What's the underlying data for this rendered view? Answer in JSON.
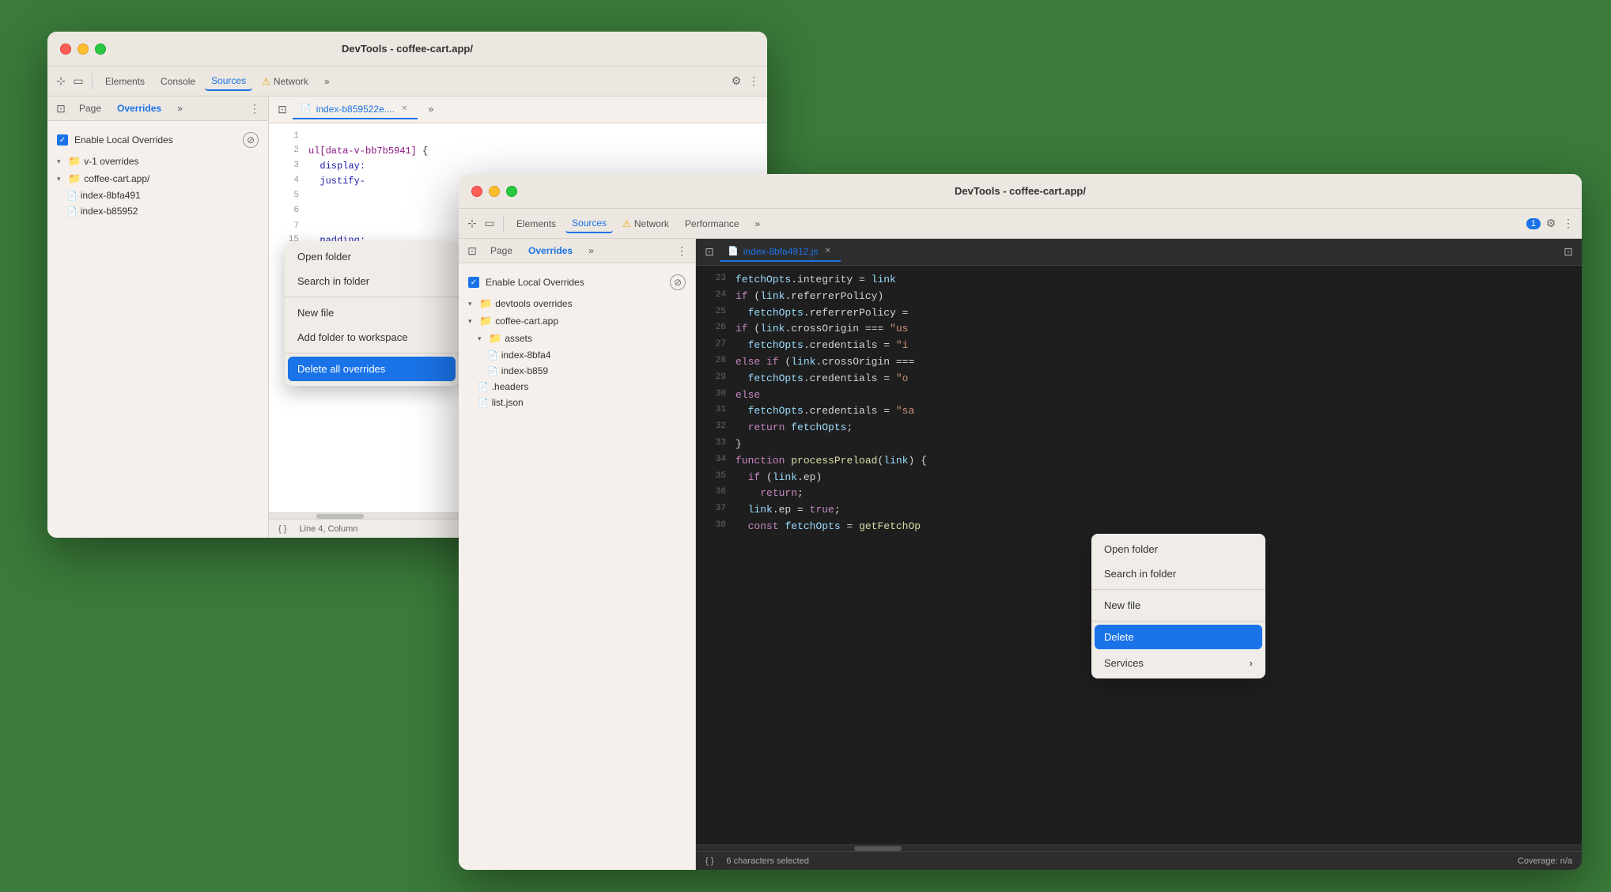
{
  "windows": {
    "back": {
      "title": "DevTools - coffee-cart.app/",
      "tabs": [
        "Elements",
        "Console",
        "Sources",
        "Network"
      ],
      "active_tab": "Sources",
      "sidebar": {
        "tabs": [
          "Page",
          "Overrides",
          ">>"
        ],
        "active_tab": "Overrides",
        "enable_overrides": "Enable Local Overrides",
        "tree": {
          "root": "v-1 overrides",
          "child": "coffee-cart.app/",
          "files": [
            "index-8bfa491",
            "index-b85952"
          ]
        }
      },
      "context_menu": {
        "items": [
          "Open folder",
          "Search in folder",
          "New file",
          "Add folder to workspace",
          "Delete all overrides"
        ]
      },
      "code_tab": "index-b859522e....",
      "code_lines": [
        {
          "num": 1,
          "text": ""
        },
        {
          "num": 2,
          "text": "ul[data-v-bb7b5941] {"
        },
        {
          "num": 3,
          "text": "  display:"
        },
        {
          "num": 4,
          "text": "  justify-"
        }
      ],
      "status": "Line 4, Column"
    },
    "front": {
      "title": "DevTools - coffee-cart.app/",
      "tabs": [
        "Elements",
        "Sources",
        "Network",
        "Performance",
        ">>"
      ],
      "active_tab": "Sources",
      "badge": "1",
      "sidebar": {
        "tabs": [
          "Page",
          "Overrides",
          ">>"
        ],
        "active_tab": "Overrides",
        "enable_overrides": "Enable Local Overrides",
        "tree": {
          "root": "devtools overrides",
          "child": "coffee-cart.app",
          "subchild": "assets",
          "files": [
            "index-8bfa4",
            "index-b859"
          ],
          "root_files": [
            ".headers",
            "list.json"
          ]
        }
      },
      "context_menu": {
        "items": [
          "Open folder",
          "Search in folder",
          "New file",
          "Delete",
          "Services"
        ]
      },
      "code_tab": "index-8bfa4912.js",
      "code_lines": [
        {
          "num": 23,
          "content": "fetchOpts.integrity = link"
        },
        {
          "num": 24,
          "content": "if (link.referrerPolicy)"
        },
        {
          "num": 25,
          "content": "  fetchOpts.referrerPolicy ="
        },
        {
          "num": 26,
          "content": "if (link.crossOrigin === \"us"
        },
        {
          "num": 27,
          "content": "  fetchOpts.credentials = \"i"
        },
        {
          "num": 28,
          "content": "else if (link.crossOrigin ==="
        },
        {
          "num": 29,
          "content": "  fetchOpts.credentials = \"o"
        },
        {
          "num": 30,
          "content": "else"
        },
        {
          "num": 31,
          "content": "  fetchOpts.credentials = \"sa"
        },
        {
          "num": 32,
          "content": "  return fetchOpts;"
        },
        {
          "num": 33,
          "content": "}"
        },
        {
          "num": 34,
          "content": "function processPreload(link) {"
        },
        {
          "num": 35,
          "content": "  if (link.ep)"
        },
        {
          "num": 36,
          "content": "    return;"
        },
        {
          "num": 37,
          "content": "  link.ep = true;"
        },
        {
          "num": 38,
          "content": "  const fetchOpts = getFetchOp"
        }
      ],
      "status_left": "6 characters selected",
      "status_right": "Coverage: n/a"
    }
  }
}
